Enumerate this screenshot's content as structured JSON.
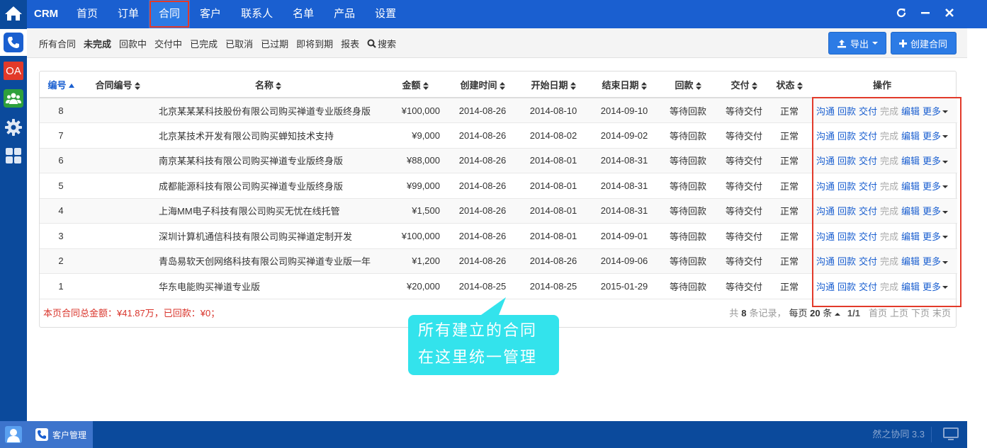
{
  "app": {
    "brand": "CRM"
  },
  "nav": {
    "items": [
      "首页",
      "订单",
      "合同",
      "客户",
      "联系人",
      "名单",
      "产品",
      "设置"
    ],
    "active_index": 2
  },
  "dock": {
    "icons": [
      "home-icon",
      "phone-icon",
      "oa-icon",
      "team-icon",
      "gear-icon",
      "apps-grid-icon"
    ],
    "oa_label": "OA"
  },
  "window_controls": [
    "refresh-icon",
    "minimize-icon",
    "close-icon"
  ],
  "filters": {
    "items": [
      "所有合同",
      "未完成",
      "回款中",
      "交付中",
      "已完成",
      "已取消",
      "已过期",
      "即将到期",
      "报表"
    ],
    "bold_index": 1,
    "search_label": "搜索"
  },
  "actions": {
    "export_label": "导出",
    "create_label": "创建合同"
  },
  "table": {
    "headers": [
      "编号",
      "合同编号",
      "名称",
      "金额",
      "创建时间",
      "开始日期",
      "结束日期",
      "回款",
      "交付",
      "状态",
      "操作"
    ],
    "rows": [
      {
        "id": "8",
        "contract_no": "",
        "name": "北京某某某科技股份有限公司购买禅道专业版终身版",
        "amount": "¥100,000",
        "created": "2014-08-26",
        "start": "2014-08-10",
        "end": "2014-09-10",
        "payment": "等待回款",
        "delivery": "等待交付",
        "status": "正常"
      },
      {
        "id": "7",
        "contract_no": "",
        "name": "北京某技术开发有限公司购买蝉知技术支持",
        "amount": "¥9,000",
        "created": "2014-08-26",
        "start": "2014-08-02",
        "end": "2014-09-02",
        "payment": "等待回款",
        "delivery": "等待交付",
        "status": "正常"
      },
      {
        "id": "6",
        "contract_no": "",
        "name": "南京某某科技有限公司购买禅道专业版终身版",
        "amount": "¥88,000",
        "created": "2014-08-26",
        "start": "2014-08-01",
        "end": "2014-08-31",
        "payment": "等待回款",
        "delivery": "等待交付",
        "status": "正常"
      },
      {
        "id": "5",
        "contract_no": "",
        "name": "成都能源科技有限公司购买禅道专业版终身版",
        "amount": "¥99,000",
        "created": "2014-08-26",
        "start": "2014-08-01",
        "end": "2014-08-31",
        "payment": "等待回款",
        "delivery": "等待交付",
        "status": "正常"
      },
      {
        "id": "4",
        "contract_no": "",
        "name": "上海MM电子科技有限公司购买无忧在线托管",
        "amount": "¥1,500",
        "created": "2014-08-26",
        "start": "2014-08-01",
        "end": "2014-08-31",
        "payment": "等待回款",
        "delivery": "等待交付",
        "status": "正常"
      },
      {
        "id": "3",
        "contract_no": "",
        "name": "深圳计算机通信科技有限公司购买禅道定制开发",
        "amount": "¥100,000",
        "created": "2014-08-26",
        "start": "2014-08-01",
        "end": "2014-09-01",
        "payment": "等待回款",
        "delivery": "等待交付",
        "status": "正常"
      },
      {
        "id": "2",
        "contract_no": "",
        "name": "青岛易软天创网络科技有限公司购买禅道专业版一年",
        "amount": "¥1,200",
        "created": "2014-08-26",
        "start": "2014-08-26",
        "end": "2014-09-06",
        "payment": "等待回款",
        "delivery": "等待交付",
        "status": "正常"
      },
      {
        "id": "1",
        "contract_no": "",
        "name": "华东电能购买禅道专业版",
        "amount": "¥20,000",
        "created": "2014-08-25",
        "start": "2014-08-25",
        "end": "2015-01-29",
        "payment": "等待回款",
        "delivery": "等待交付",
        "status": "正常"
      }
    ],
    "row_actions": {
      "communicate": "沟通",
      "payment": "回款",
      "delivery": "交付",
      "complete": "完成",
      "edit": "编辑",
      "more": "更多"
    }
  },
  "summary": {
    "total_text": "本页合同总金额：¥41.87万，已回款：¥0；"
  },
  "pager": {
    "prefix": "共",
    "total": "8",
    "suffix": "条记录，",
    "per_page_prefix": "每页",
    "per_page": "20",
    "per_page_suffix": "条",
    "pages": "1/1",
    "first": "首页",
    "prev": "上页",
    "next": "下页",
    "last": "末页"
  },
  "callout": {
    "line1": "所有建立的合同",
    "line2": "在这里统一管理"
  },
  "taskbar": {
    "task_label": "客户管理",
    "version": "然之协同 3.3"
  },
  "colors": {
    "primary": "#1a5fd0",
    "dock": "#0b4a9c",
    "highlight": "#e23a2a",
    "callout": "#33e3ec",
    "total_text": "#d9342b"
  }
}
